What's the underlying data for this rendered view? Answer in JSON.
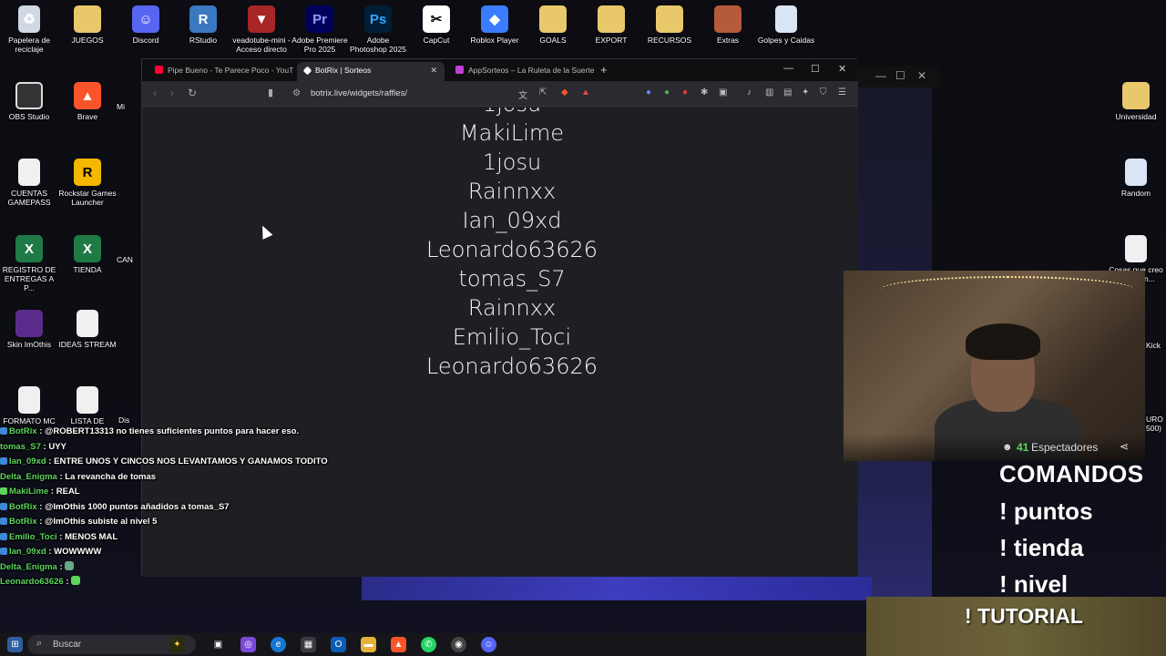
{
  "desktop": {
    "icons": [
      {
        "label": "Papelera de reciclaje"
      },
      {
        "label": "JUEGOS"
      },
      {
        "label": "Discord"
      },
      {
        "label": "RStudio"
      },
      {
        "label": "veadotube-mini - Acceso directo"
      },
      {
        "label": "Adobe Premiere Pro 2025"
      },
      {
        "label": "Adobe Photoshop 2025"
      },
      {
        "label": "CapCut"
      },
      {
        "label": "Roblox Player"
      },
      {
        "label": "GOALS"
      },
      {
        "label": "EXPORT"
      },
      {
        "label": "RECURSOS"
      },
      {
        "label": "Extras"
      },
      {
        "label": "Golpes y Caidas"
      },
      {
        "label": "OBS Studio"
      },
      {
        "label": "Brave"
      },
      {
        "label": "CUENTAS GAMEPASS"
      },
      {
        "label": "Rockstar Games Launcher"
      },
      {
        "label": "REGISTRO DE ENTREGAS A P..."
      },
      {
        "label": "TIENDA"
      },
      {
        "label": "Skin ImOthis"
      },
      {
        "label": "IDEAS STREAM"
      },
      {
        "label": "FORMATO MC"
      },
      {
        "label": "LISTA DE"
      },
      {
        "label": "Universidad"
      },
      {
        "label": "Random"
      },
      {
        "label": "Cosas que creo que se in..."
      }
    ],
    "partial_labels": {
      "mi": "Mi",
      "can": "CAN",
      "dis": "Dis",
      "kick": "Kick",
      "uro": "URO 500)"
    }
  },
  "browser": {
    "tabs": [
      {
        "label": "Pipe Bueno - Te Parece Poco - YouTube",
        "color": "#ff0033"
      },
      {
        "label": "BotRix | Sorteos",
        "color": "#ffffff"
      },
      {
        "label": "AppSorteos – La Ruleta de la Suerte",
        "color": "#c23fd4"
      }
    ],
    "tab_close": "✕",
    "new_tab": "+",
    "url": "botrix.live/widgets/raffles/",
    "raffle_names": [
      "1josu",
      "MakiLime",
      "1josu",
      "Rainnxx",
      "Ian_09xd",
      "Leonardo63626",
      "tomas_S7",
      "Rainnxx",
      "Emilio_Toci",
      "Leonardo63626"
    ]
  },
  "webcam": {
    "viewer_count": "41",
    "viewer_label": "Espectadores"
  },
  "overlay": {
    "commands_title": "COMANDOS",
    "commands": [
      "! puntos",
      "! tienda",
      "! nivel"
    ],
    "tutorial": "! TUTORIAL"
  },
  "chat": [
    {
      "user": "BotRix",
      "user_color": "#5cd65c",
      "text": "@ROBERT13313 no tienes suficientes puntos para hacer eso."
    },
    {
      "user": "tomas_S7",
      "user_color": "#5cd65c",
      "text": "UYY"
    },
    {
      "user": "Ian_09xd",
      "user_color": "#5cd65c",
      "text": "ENTRE UNOS Y CINCOS NOS LEVANTAMOS Y GANAMOS TODITO"
    },
    {
      "user": "Delta_Enigma",
      "user_color": "#5cd65c",
      "text": "La revancha de tomas"
    },
    {
      "user": "MakiLime",
      "user_color": "#5cd65c",
      "text": "REAL"
    },
    {
      "user": "BotRix",
      "user_color": "#5cd65c",
      "text": "@ImOthis 1000 puntos añadidos a tomas_S7"
    },
    {
      "user": "BotRix",
      "user_color": "#5cd65c",
      "text": "@ImOthis subiste al nivel 5"
    },
    {
      "user": "Emilio_Toci",
      "user_color": "#5cd65c",
      "text": "MENOS MAL"
    },
    {
      "user": "Ian_09xd",
      "user_color": "#5cd65c",
      "text": "WOWWWW"
    },
    {
      "user": "Delta_Enigma",
      "user_color": "#5cd65c",
      "text": ""
    },
    {
      "user": "Leonardo63626",
      "user_color": "#5cd65c",
      "text": ""
    }
  ],
  "taskbar": {
    "search_placeholder": "Buscar"
  }
}
